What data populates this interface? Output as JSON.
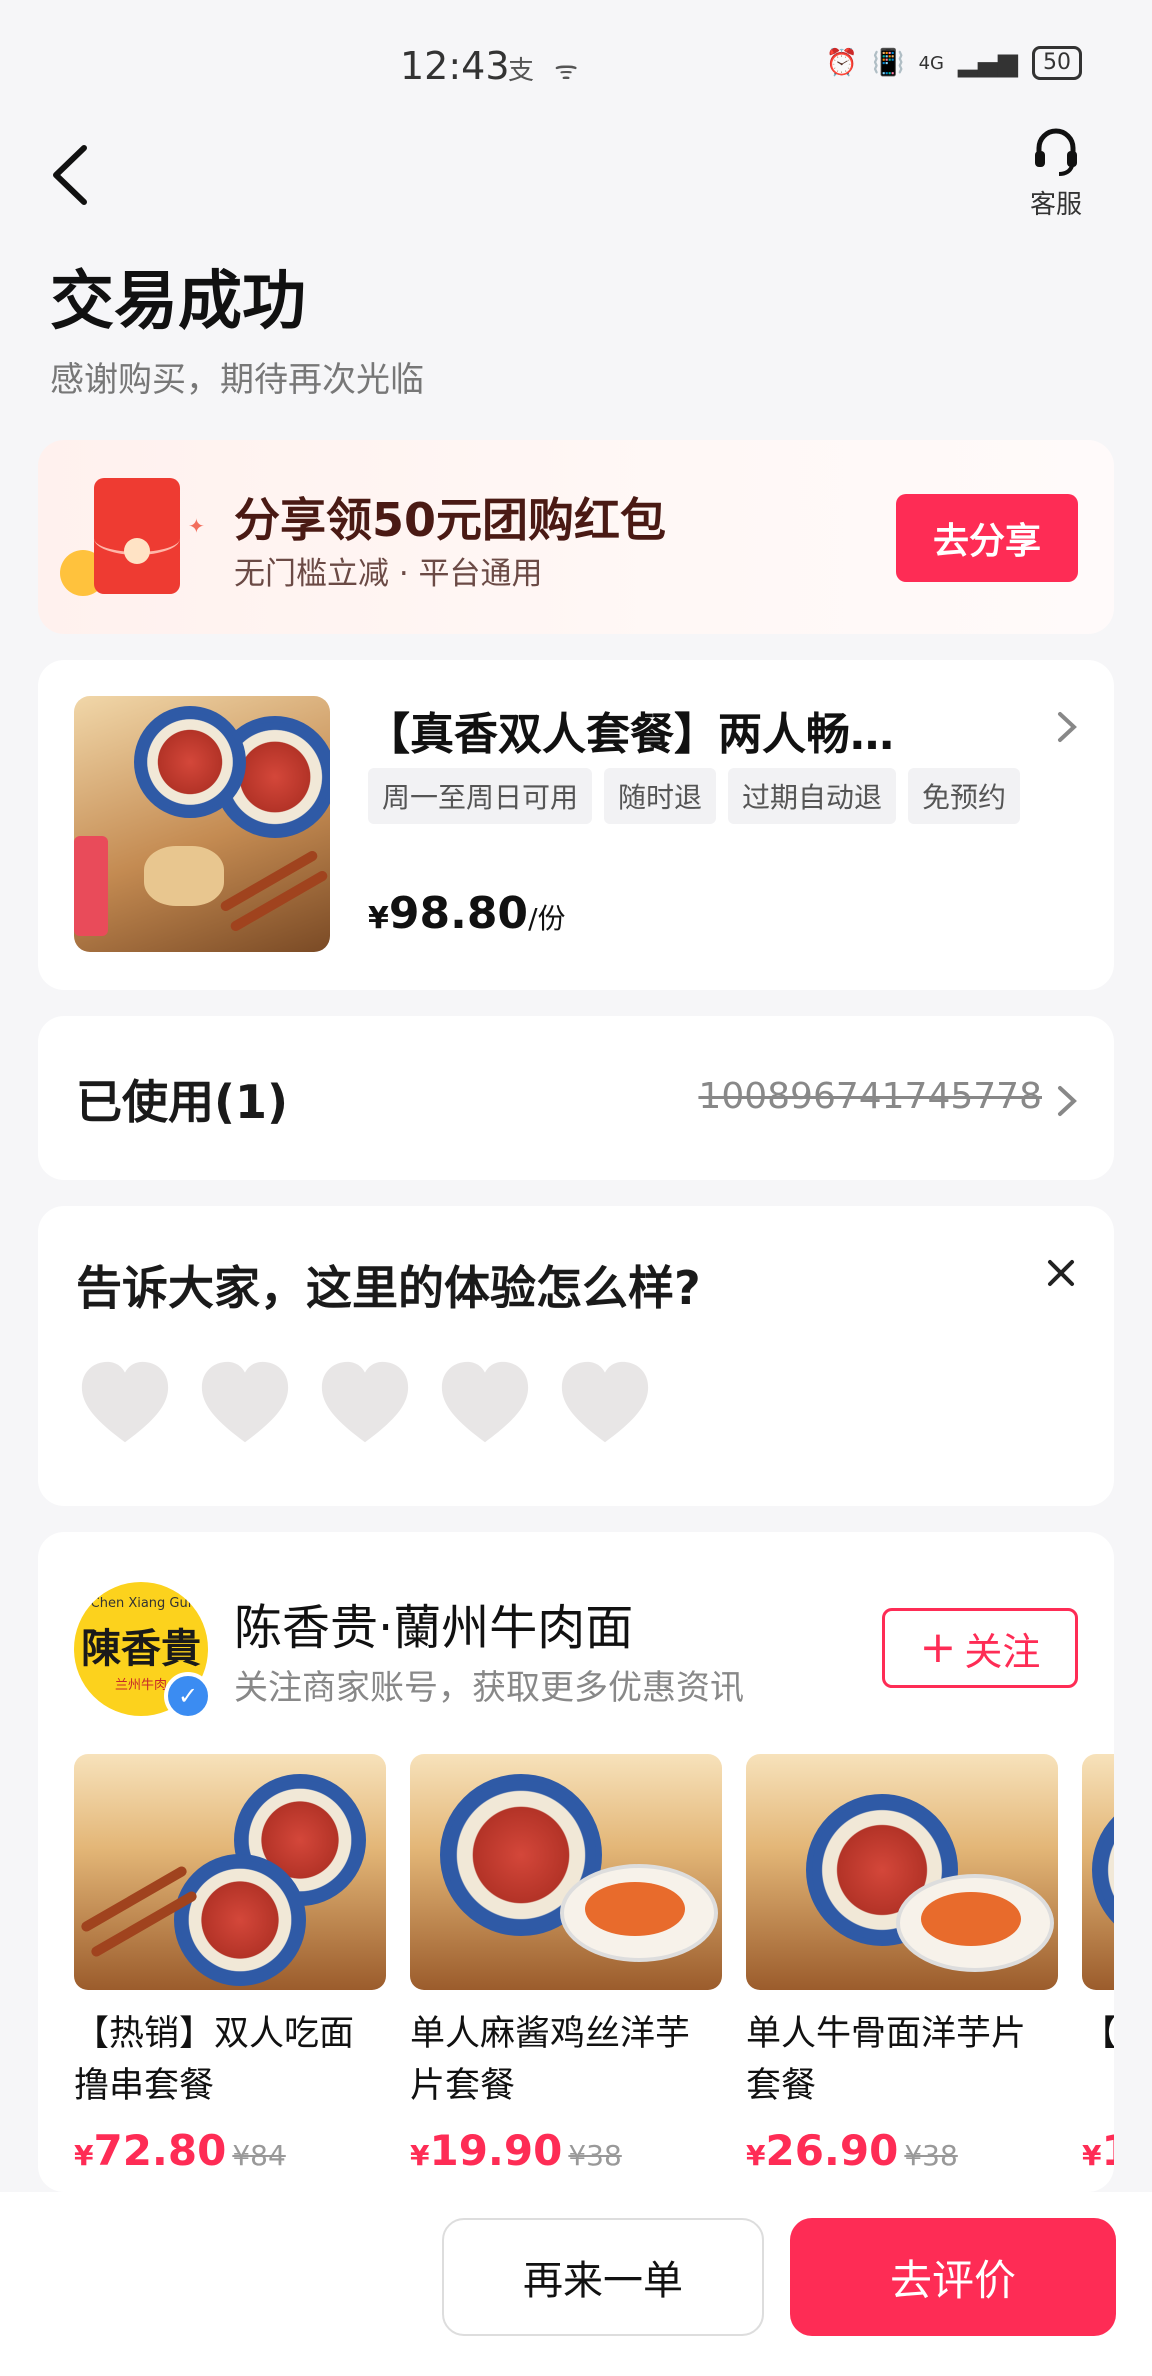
{
  "status_bar": {
    "time": "12:43",
    "left_icons": "支 ᯤ",
    "network": "4G",
    "battery": "50"
  },
  "header": {
    "back_icon": "chevron-left-icon",
    "customer_service_label": "客服",
    "title": "交易成功",
    "subtitle": "感谢购买，期待再次光临"
  },
  "share_banner": {
    "title": "分享领50元团购红包",
    "subtitle": "无门槛立减 · 平台通用",
    "button_label": "去分享"
  },
  "product": {
    "title": "【真香双人套餐】两人畅…",
    "tags": [
      "周一至周日可用",
      "随时退",
      "过期自动退",
      "免预约"
    ],
    "currency": "¥",
    "price": "98.80",
    "unit": "/份"
  },
  "usage": {
    "label": "已使用(1)",
    "order_number": "100896741745778"
  },
  "review_prompt": {
    "question": "告诉大家，这里的体验怎么样?",
    "rating_max": 5,
    "rating_value": 0
  },
  "merchant": {
    "logo_text_top": "Chen Xiang Gui",
    "logo_text_main": "陳香貴",
    "logo_text_bottom": "兰州牛肉",
    "name": "陈香贵·蘭州牛肉面",
    "subtitle": "关注商家账号，获取更多优惠资讯",
    "follow_label": "关注",
    "goods": [
      {
        "name": "【热销】双人吃面撸串套餐",
        "currency": "¥",
        "price": "72.80",
        "old_price": "¥84"
      },
      {
        "name": "单人麻酱鸡丝洋芋片套餐",
        "currency": "¥",
        "price": "19.90",
        "old_price": "¥38"
      },
      {
        "name": "单人牛骨面洋芋片套餐",
        "currency": "¥",
        "price": "26.90",
        "old_price": "¥38"
      },
      {
        "name": "【超",
        "currency": "¥",
        "price": "1",
        "old_price": ""
      }
    ]
  },
  "bottom_bar": {
    "reorder_label": "再来一单",
    "review_label": "去评价"
  },
  "colors": {
    "accent": "#fe2c55",
    "background": "#f6f6f8",
    "heart_empty": "#e8e6e6"
  }
}
